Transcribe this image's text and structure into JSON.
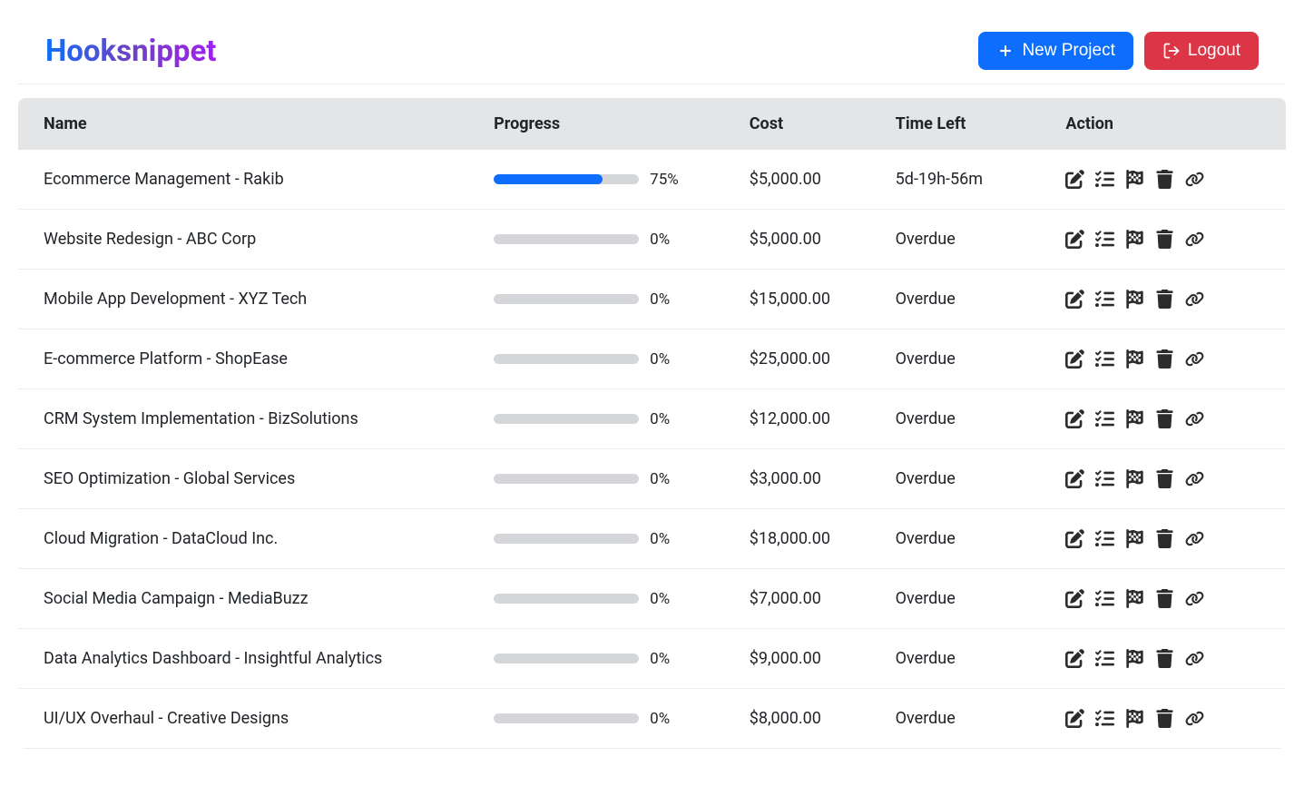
{
  "brand": "Hooksnippet",
  "header": {
    "newProject": "New Project",
    "logout": "Logout"
  },
  "table": {
    "headers": {
      "name": "Name",
      "progress": "Progress",
      "cost": "Cost",
      "timeLeft": "Time Left",
      "action": "Action"
    },
    "rows": [
      {
        "name": "Ecommerce Management - Rakib",
        "progress": 75,
        "progressLabel": "75%",
        "cost": "$5,000.00",
        "timeLeft": "5d-19h-56m"
      },
      {
        "name": "Website Redesign - ABC Corp",
        "progress": 0,
        "progressLabel": "0%",
        "cost": "$5,000.00",
        "timeLeft": "Overdue"
      },
      {
        "name": "Mobile App Development - XYZ Tech",
        "progress": 0,
        "progressLabel": "0%",
        "cost": "$15,000.00",
        "timeLeft": "Overdue"
      },
      {
        "name": "E-commerce Platform - ShopEase",
        "progress": 0,
        "progressLabel": "0%",
        "cost": "$25,000.00",
        "timeLeft": "Overdue"
      },
      {
        "name": "CRM System Implementation - BizSolutions",
        "progress": 0,
        "progressLabel": "0%",
        "cost": "$12,000.00",
        "timeLeft": "Overdue"
      },
      {
        "name": "SEO Optimization - Global Services",
        "progress": 0,
        "progressLabel": "0%",
        "cost": "$3,000.00",
        "timeLeft": "Overdue"
      },
      {
        "name": "Cloud Migration - DataCloud Inc.",
        "progress": 0,
        "progressLabel": "0%",
        "cost": "$18,000.00",
        "timeLeft": "Overdue"
      },
      {
        "name": "Social Media Campaign - MediaBuzz",
        "progress": 0,
        "progressLabel": "0%",
        "cost": "$7,000.00",
        "timeLeft": "Overdue"
      },
      {
        "name": "Data Analytics Dashboard - Insightful Analytics",
        "progress": 0,
        "progressLabel": "0%",
        "cost": "$9,000.00",
        "timeLeft": "Overdue"
      },
      {
        "name": "UI/UX Overhaul - Creative Designs",
        "progress": 0,
        "progressLabel": "0%",
        "cost": "$8,000.00",
        "timeLeft": "Overdue"
      }
    ]
  }
}
